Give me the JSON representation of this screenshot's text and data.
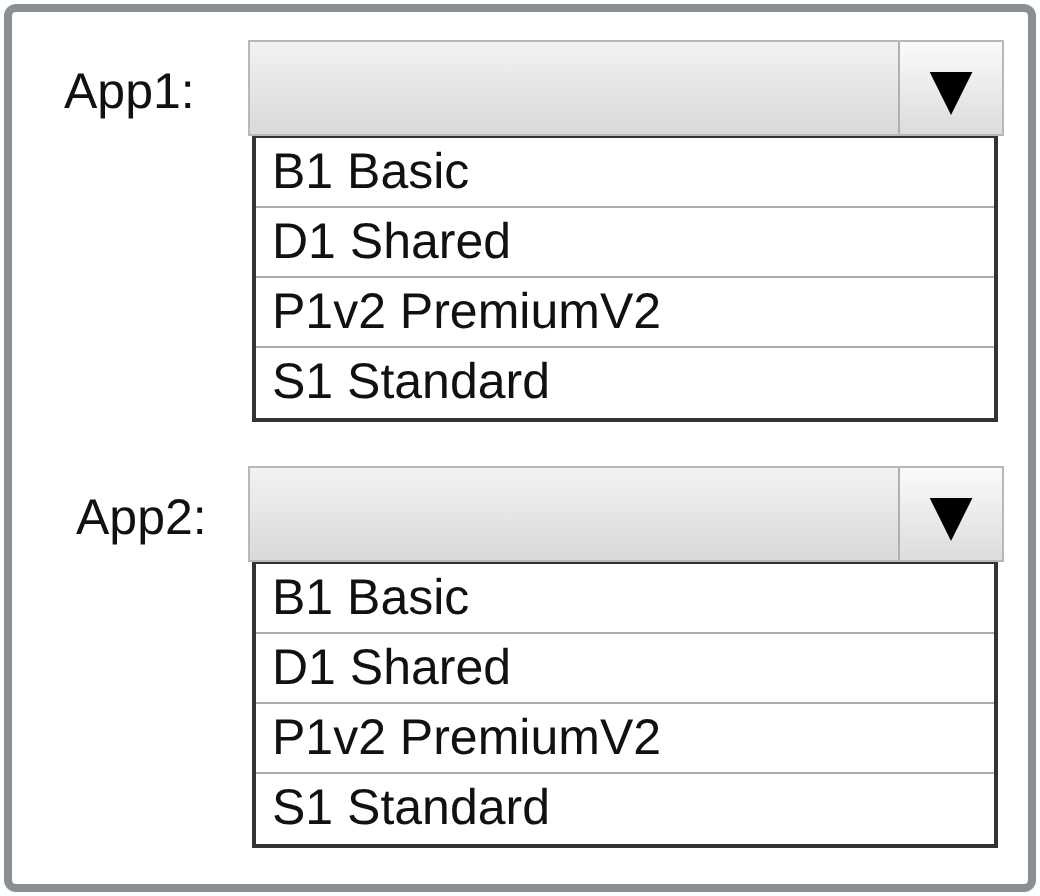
{
  "dropdowns": [
    {
      "label": "App1:",
      "arrow": "▼",
      "expanded": true,
      "options": [
        "B1 Basic",
        "D1 Shared",
        "P1v2 PremiumV2",
        "S1 Standard"
      ]
    },
    {
      "label": "App2:",
      "arrow": "▼",
      "expanded": true,
      "options": [
        "B1 Basic",
        "D1 Shared",
        "P1v2 PremiumV2",
        "S1 Standard"
      ]
    }
  ]
}
